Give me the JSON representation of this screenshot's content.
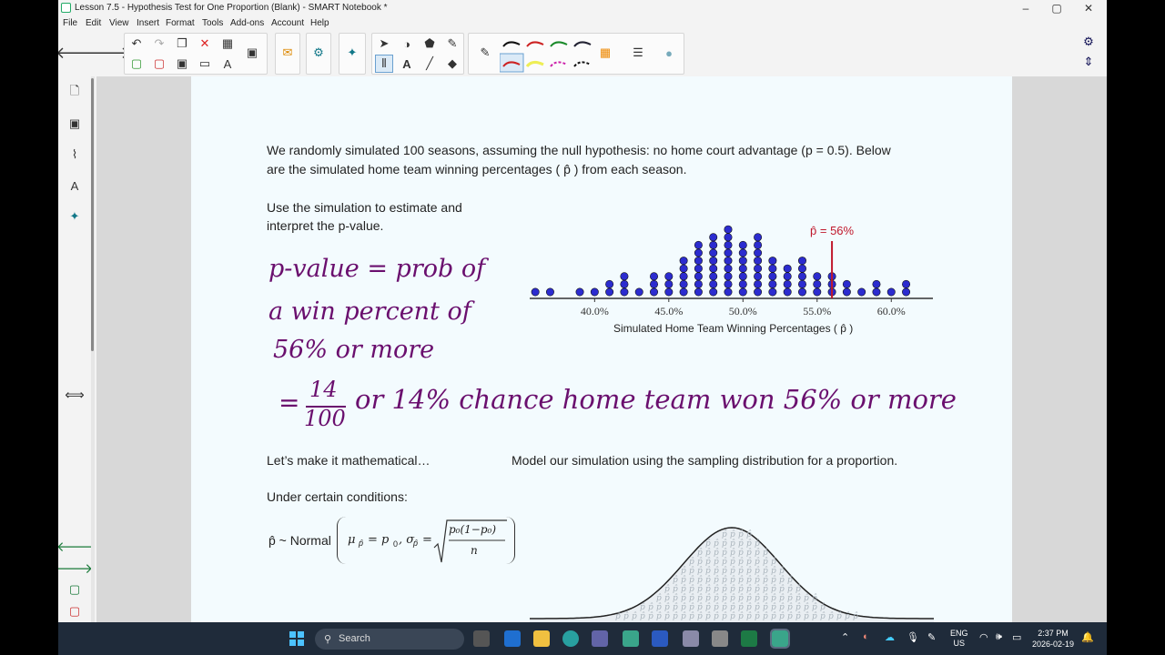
{
  "window": {
    "title": "Lesson 7.5 - Hypothesis Test for One Proportion (Blank) - SMART Notebook *",
    "minimize": "–",
    "maximize": "▢",
    "close": "✕"
  },
  "menu": [
    "File",
    "Edit",
    "View",
    "Insert",
    "Format",
    "Tools",
    "Add-ons",
    "Account",
    "Help"
  ],
  "page": {
    "intro_line1": "We randomly simulated 100 seasons, assuming the null hypothesis: no home court advantage (p = 0.5). Below",
    "intro_line2": "are the simulated home team winning percentages ( p̂ ) from each season.",
    "prompt_line1": "Use the simulation to estimate and",
    "prompt_line2": "interpret the p-value.",
    "math_heading": "Let’s make it mathematical…",
    "model_heading": "Model our simulation using the sampling distribution for a proportion.",
    "conditions": "Under certain conditions:",
    "formula_lhs": "p̂ ~ Normal",
    "formula_mu": "μ",
    "formula_mu_rhs": "= p",
    "formula_sigma": ", σ",
    "formula_num": "p₀(1−p₀)",
    "formula_den": "n"
  },
  "ink": {
    "line1": "p-value = prob of",
    "line2": "a win percent of",
    "line3": "56% or more",
    "eq_prefix": "=",
    "frac_num": "14",
    "frac_den": "100",
    "line4": "or 14% chance home team won 56% or more"
  },
  "chart_data": {
    "type": "scatter",
    "title": "",
    "xlabel": "Simulated Home Team Winning Percentages ( p̂ )",
    "ylabel": "",
    "x_ticks": [
      "40.0%",
      "45.0%",
      "50.0%",
      "55.0%",
      "60.0%"
    ],
    "x_tick_values": [
      40,
      45,
      50,
      55,
      60
    ],
    "xlim": [
      35.5,
      62.5
    ],
    "observed_label": "p̂ = 56%",
    "observed_value": 56,
    "dot_color": "#2c2ccf",
    "marker_color": "#c0182c",
    "points": [
      {
        "x": 36,
        "count": 1
      },
      {
        "x": 37,
        "count": 1
      },
      {
        "x": 39,
        "count": 1
      },
      {
        "x": 40,
        "count": 1
      },
      {
        "x": 41,
        "count": 2
      },
      {
        "x": 42,
        "count": 3
      },
      {
        "x": 43,
        "count": 1
      },
      {
        "x": 44,
        "count": 3
      },
      {
        "x": 45,
        "count": 3
      },
      {
        "x": 46,
        "count": 5
      },
      {
        "x": 47,
        "count": 7
      },
      {
        "x": 48,
        "count": 8
      },
      {
        "x": 49,
        "count": 9
      },
      {
        "x": 50,
        "count": 7
      },
      {
        "x": 51,
        "count": 8
      },
      {
        "x": 52,
        "count": 5
      },
      {
        "x": 53,
        "count": 4
      },
      {
        "x": 54,
        "count": 5
      },
      {
        "x": 55,
        "count": 3
      },
      {
        "x": 56,
        "count": 3
      },
      {
        "x": 57,
        "count": 2
      },
      {
        "x": 58,
        "count": 1
      },
      {
        "x": 59,
        "count": 2
      },
      {
        "x": 60,
        "count": 1
      },
      {
        "x": 61,
        "count": 2
      }
    ]
  },
  "curve_data": {
    "type": "area",
    "fill_glyph": "p̂",
    "mean": 50,
    "sd": 5
  },
  "taskbar": {
    "search_placeholder": "Search",
    "lang": "ENG",
    "region": "US",
    "time": "2:37 PM",
    "date": "2026-02-19"
  }
}
